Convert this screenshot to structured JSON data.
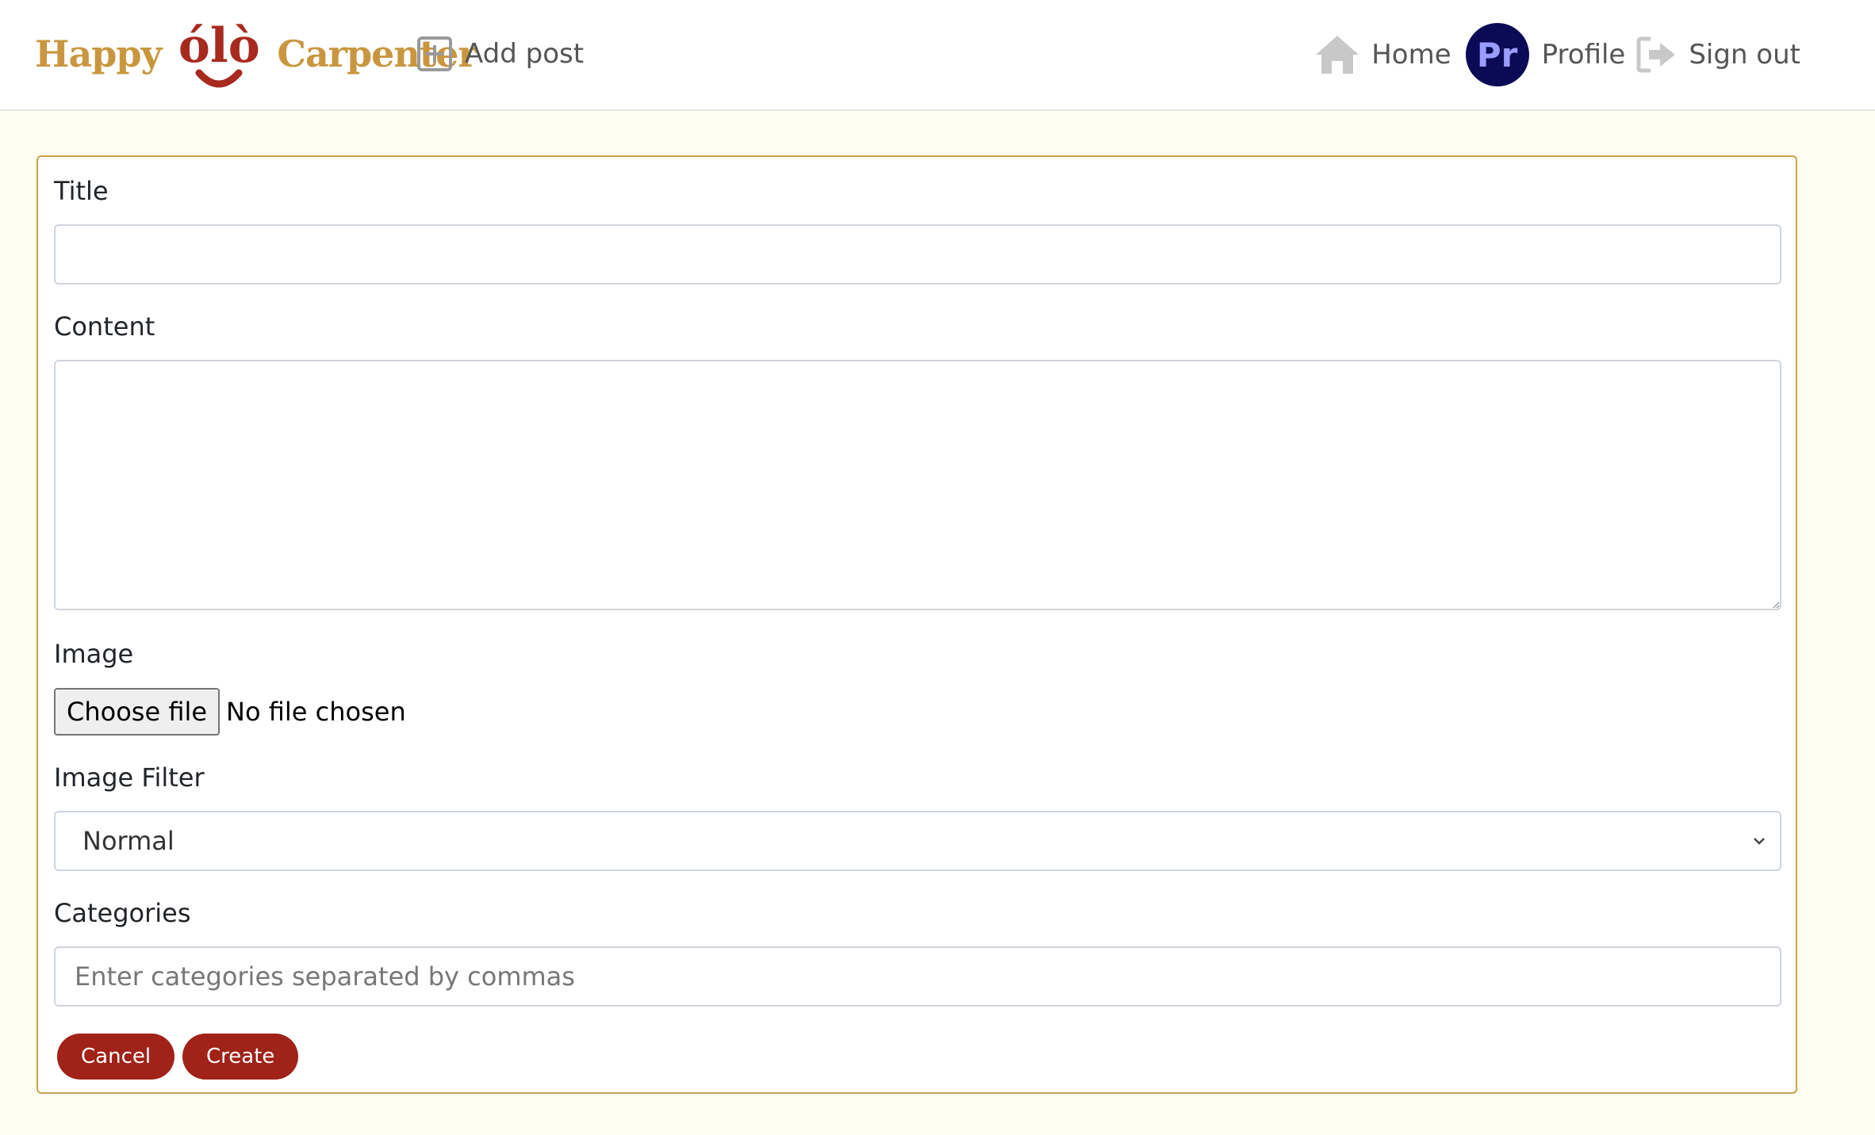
{
  "brand": {
    "left_word": "Happy",
    "logo_text": "ólò",
    "right_word": "Carpenter"
  },
  "nav": {
    "add_post": {
      "label": "Add post",
      "icon": "plus-square-icon"
    },
    "home": {
      "label": "Home",
      "icon": "home-icon"
    },
    "profile": {
      "label": "Profile",
      "avatar_initials": "Pr"
    },
    "sign_out": {
      "label": "Sign out",
      "icon": "sign-out-icon"
    }
  },
  "form": {
    "title": {
      "label": "Title",
      "value": ""
    },
    "content": {
      "label": "Content",
      "value": ""
    },
    "image": {
      "label": "Image",
      "button": "Choose file",
      "status": "No file chosen"
    },
    "filter": {
      "label": "Image Filter",
      "selected": "Normal"
    },
    "categories": {
      "label": "Categories",
      "placeholder": "Enter categories separated by commas"
    },
    "cancel": "Cancel",
    "create": "Create"
  },
  "colors": {
    "brand_gold": "#c9963f",
    "brand_red": "#a8291e",
    "button": "#a02218",
    "avatar_bg": "#0b0a57",
    "page_bg": "#fefdf0",
    "card_border": "#c9a24a"
  }
}
